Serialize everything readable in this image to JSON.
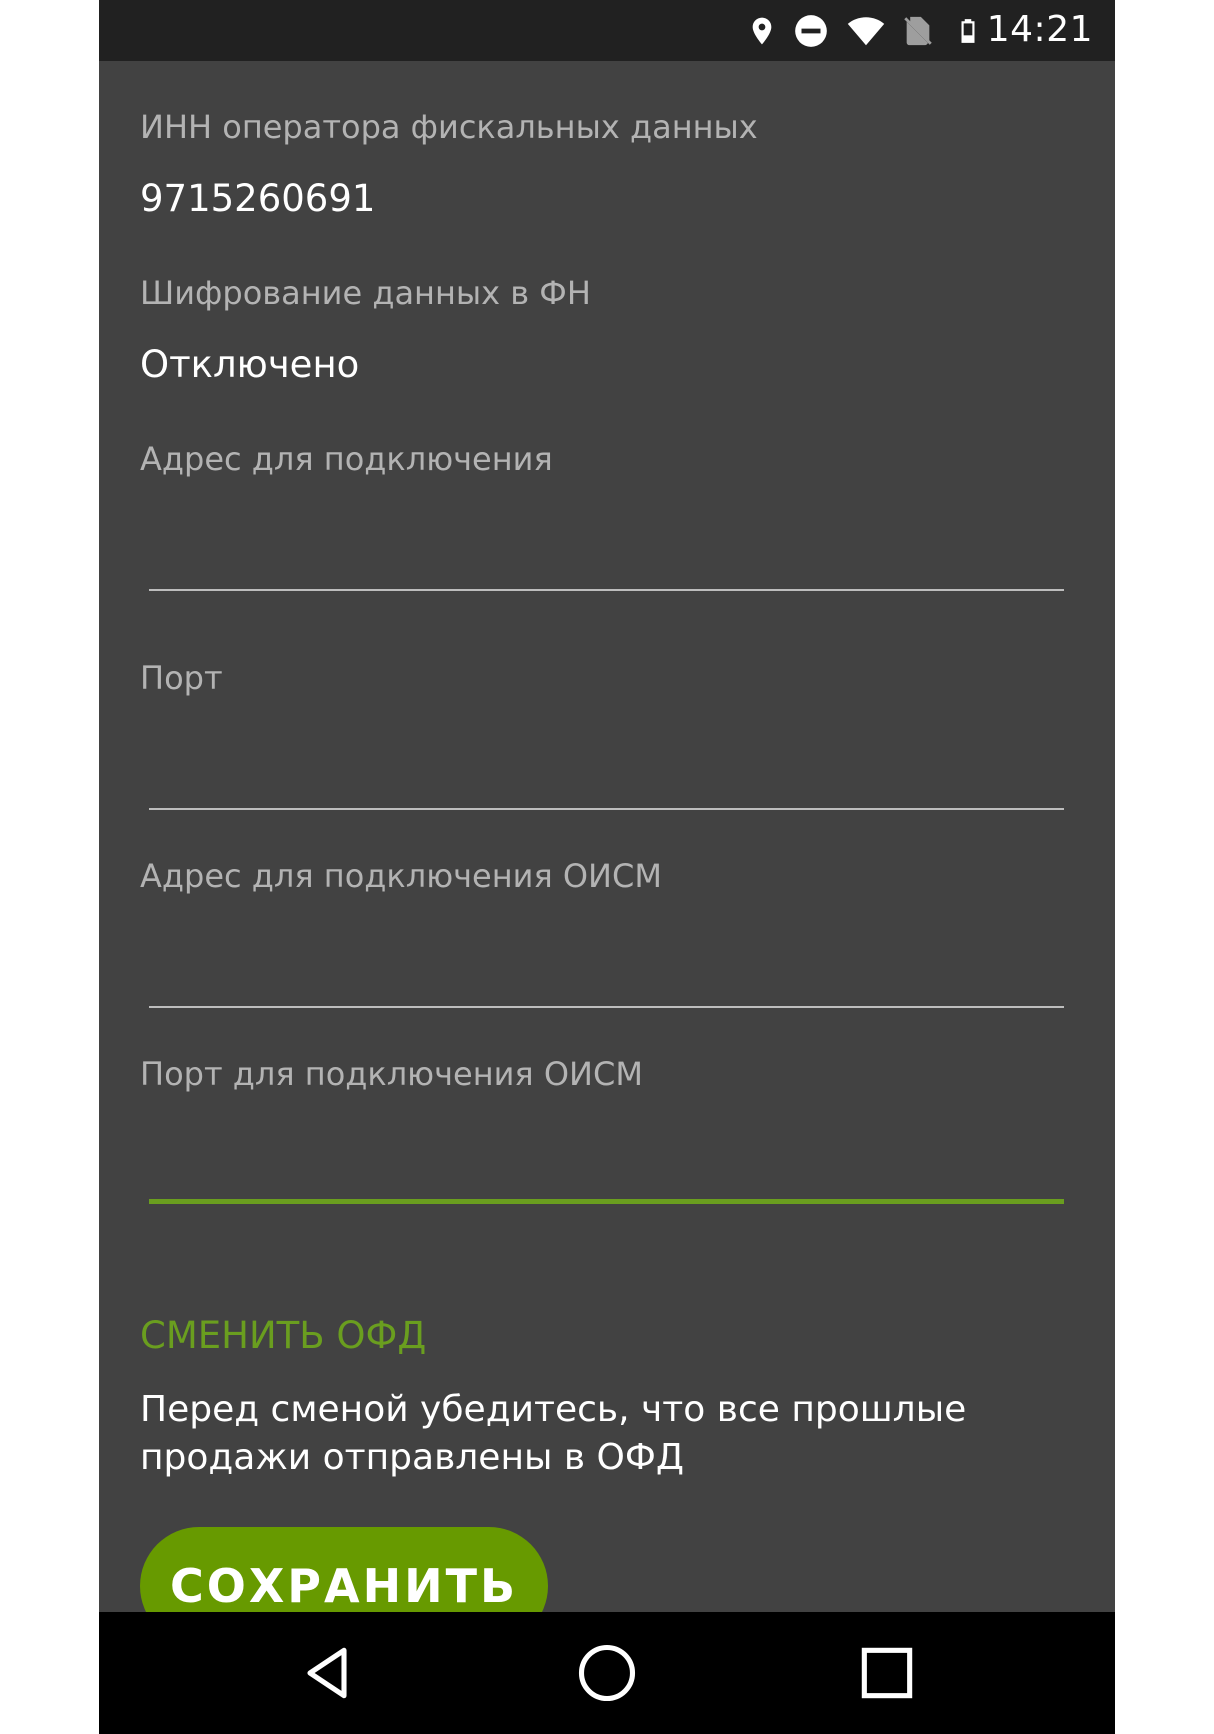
{
  "status_bar": {
    "time": "14:21",
    "icons": [
      "location-icon",
      "do-not-disturb-icon",
      "wifi-icon",
      "no-sim-icon",
      "battery-icon"
    ]
  },
  "fields": [
    {
      "label": "ИНН оператора фискальных данных",
      "value": "9715260691"
    },
    {
      "label": "Шифрование данных в ФН",
      "value": "Отключено"
    }
  ],
  "inputs": [
    {
      "label": "Адрес для подключения",
      "value": ""
    },
    {
      "label": "Порт",
      "value": ""
    },
    {
      "label": "Адрес для подключения ОИСМ",
      "value": ""
    },
    {
      "label": "Порт для подключения ОИСМ",
      "value": ""
    }
  ],
  "change_ofd": {
    "label": "СМЕНИТЬ ОФД",
    "warning": "Перед сменой убедитесь, что все прошлые продажи отправлены в ОФД"
  },
  "save_button": {
    "label": "СОХРАНИТЬ"
  },
  "nav_bar": {
    "icons": [
      "back-icon",
      "home-icon",
      "recents-icon"
    ]
  },
  "colors": {
    "background": "#424242",
    "status_bar": "#212121",
    "accent": "#6a9e1f",
    "button": "#679a00",
    "label_text": "#b3b3b3",
    "value_text": "#ffffff"
  }
}
